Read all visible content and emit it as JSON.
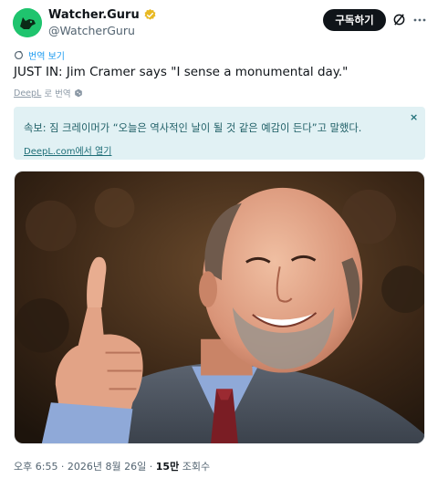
{
  "author": {
    "name": "Watcher.Guru",
    "handle": "@WatcherGuru",
    "verified": true,
    "verified_color": "#e8b923",
    "avatar_color": "#1fc46e",
    "avatar_icon": "dog-silhouette-icon"
  },
  "header": {
    "follow_label": "구독하기",
    "grok_icon": "grok-icon",
    "more_icon": "more-dots-icon"
  },
  "translate": {
    "label": "번역 보기",
    "icon": "translate-icon"
  },
  "tweet": {
    "text": "JUST IN: Jim Cramer says \"I sense a monumental day.\""
  },
  "deepl": {
    "brand": "DeepL",
    "suffix": "로 번역"
  },
  "translation_box": {
    "text": "속보: 짐 크레이머가 “오늘은 역사적인 날이 될 것 같은 예감이 든다”고 말했다.",
    "link": "DeepL.com에서 열기",
    "close": "×"
  },
  "photo": {
    "description_icon": "photo-image"
  },
  "meta": {
    "time": "오후 6:55 · 2026년 8월 26일 · ",
    "views_count": "15만",
    "views_label": " 조회수"
  },
  "colors": {
    "follow_bg": "#0f1419",
    "link_blue": "#1d9bf0",
    "translation_bg": "#e1f1f4"
  }
}
